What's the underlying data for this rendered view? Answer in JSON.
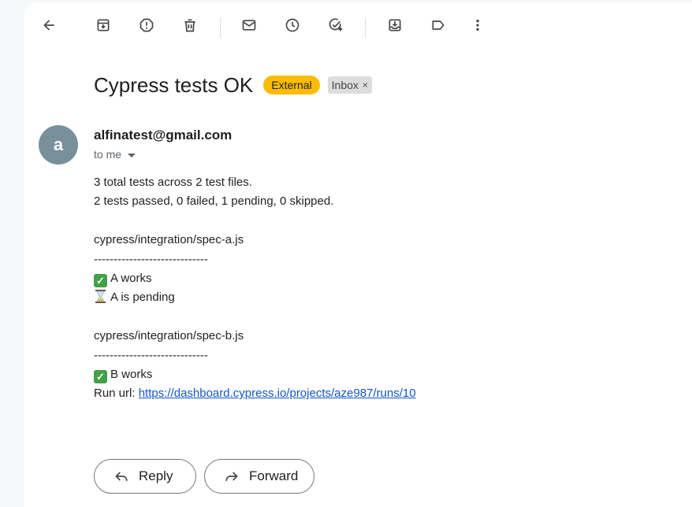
{
  "toolbar": {
    "buttons": [
      {
        "name": "back-button",
        "icon": "arrow-back-icon"
      },
      {
        "name": "archive-button",
        "icon": "archive-icon"
      },
      {
        "name": "report-spam-button",
        "icon": "report-spam-icon"
      },
      {
        "name": "delete-button",
        "icon": "trash-icon"
      },
      {
        "name": "mark-unread-button",
        "icon": "mail-icon"
      },
      {
        "name": "snooze-button",
        "icon": "clock-icon"
      },
      {
        "name": "add-task-button",
        "icon": "add-task-icon"
      },
      {
        "name": "move-to-button",
        "icon": "move-to-inbox-icon"
      },
      {
        "name": "labels-button",
        "icon": "label-icon"
      },
      {
        "name": "more-button",
        "icon": "more-vert-icon"
      }
    ]
  },
  "email": {
    "subject": "Cypress tests OK",
    "badges": {
      "external": "External",
      "inbox": "Inbox",
      "remove": "×"
    },
    "sender": {
      "avatar_letter": "a",
      "avatar_color": "#78909c",
      "email": "alfinatest@gmail.com",
      "to": "to me"
    },
    "body": {
      "summary_1": "3 total tests across 2 test files.",
      "summary_2": "2 tests passed, 0 failed, 1 pending, 0 skipped.",
      "file_a": "cypress/integration/spec-a.js",
      "divider_a": "-----------------------------",
      "a_works": "A works",
      "a_pending": "A is pending",
      "file_b": "cypress/integration/spec-b.js",
      "divider_b": "-----------------------------",
      "b_works": "B works",
      "run_url_label": "Run url: ",
      "run_url": "https://dashboard.cypress.io/projects/aze987/runs/10"
    }
  },
  "actions": {
    "reply": "Reply",
    "forward": "Forward"
  },
  "colors": {
    "external_badge": "#fbbc04",
    "inbox_badge": "#dddddd",
    "link": "#1155cc",
    "pass_check": "#43a047"
  }
}
